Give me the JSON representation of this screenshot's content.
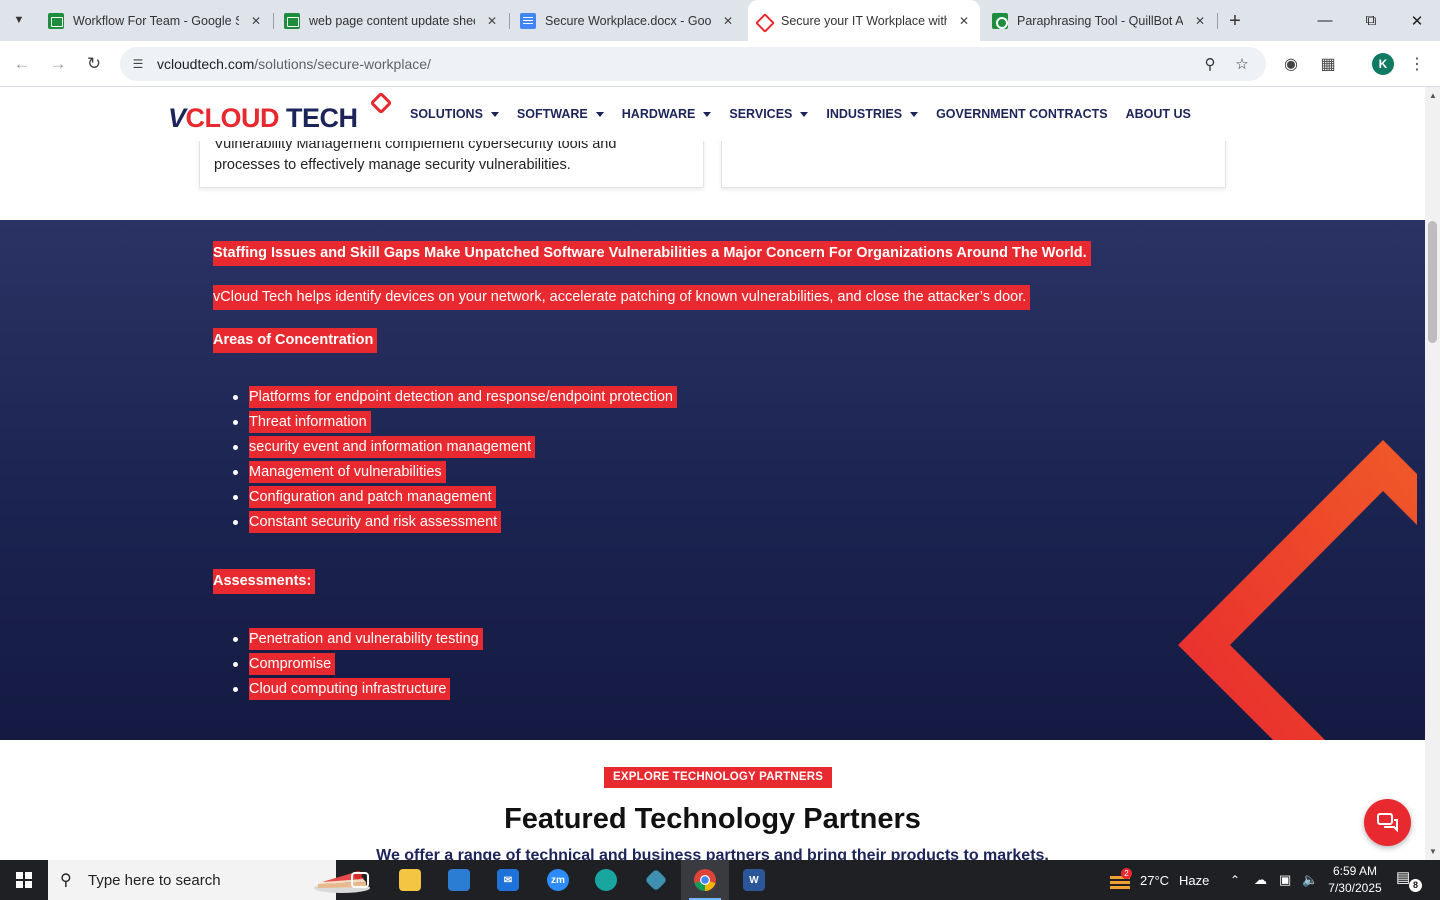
{
  "browser": {
    "tabs": [
      {
        "title": "Workflow For Team - Google Sheets",
        "icon": "sheets-icon"
      },
      {
        "title": "web page content update sheet",
        "icon": "sheets-icon"
      },
      {
        "title": "Secure Workplace.docx - Google Docs",
        "icon": "docs-icon"
      },
      {
        "title": "Secure your IT Workplace with",
        "icon": "vcloud-icon",
        "active": true
      },
      {
        "title": "Paraphrasing Tool - QuillBot AI",
        "icon": "quillbot-icon"
      }
    ],
    "url_host": "vcloudtech.com",
    "url_path": "/solutions/secure-workplace/",
    "profile_initial": "K"
  },
  "site": {
    "logo": {
      "v": "V",
      "cloud": "CLOUD",
      "tech": " TECH"
    },
    "nav": [
      {
        "label": "SOLUTIONS",
        "dropdown": true
      },
      {
        "label": "SOFTWARE",
        "dropdown": true
      },
      {
        "label": "HARDWARE",
        "dropdown": true
      },
      {
        "label": "SERVICES",
        "dropdown": true
      },
      {
        "label": "INDUSTRIES",
        "dropdown": true
      },
      {
        "label": "GOVERNMENT CONTRACTS",
        "dropdown": false
      },
      {
        "label": "ABOUT US",
        "dropdown": false
      }
    ],
    "card_left_text": "Vulnerability Management complement cybersecurity tools and processes to effectively manage security vulnerabilities.",
    "section": {
      "headline": "Staffing Issues and Skill Gaps Make Unpatched Software Vulnerabilities a Major Concern For Organizations Around The World.",
      "intro": "vCloud Tech helps identify devices on your network, accelerate patching of known vulnerabilities, and close the attacker’s door.",
      "areas_heading": "Areas of Concentration",
      "areas": [
        "Platforms for endpoint detection and response/endpoint protection",
        "Threat information",
        "security event and information management",
        "Management of vulnerabilities",
        "Configuration and patch management",
        "Constant security and risk assessment"
      ],
      "assessments_heading": "Assessments:",
      "assessments": [
        "Penetration and vulnerability testing",
        "Compromise",
        "Cloud computing infrastructure"
      ]
    },
    "partners": {
      "badge": "EXPLORE TECHNOLOGY PARTNERS",
      "title": "Featured Technology Partners",
      "subtitle": "We offer a range of technical and business partners and bring their products to markets."
    }
  },
  "taskbar": {
    "search_placeholder": "Type here to search",
    "weather_temp": "27°C",
    "weather_desc": "Haze",
    "weather_badge": "2",
    "time": "6:59 AM",
    "date": "7/30/2025",
    "notification_count": "8"
  },
  "colors": {
    "brand_red": "#e8292f",
    "brand_navy": "#1d2459"
  }
}
